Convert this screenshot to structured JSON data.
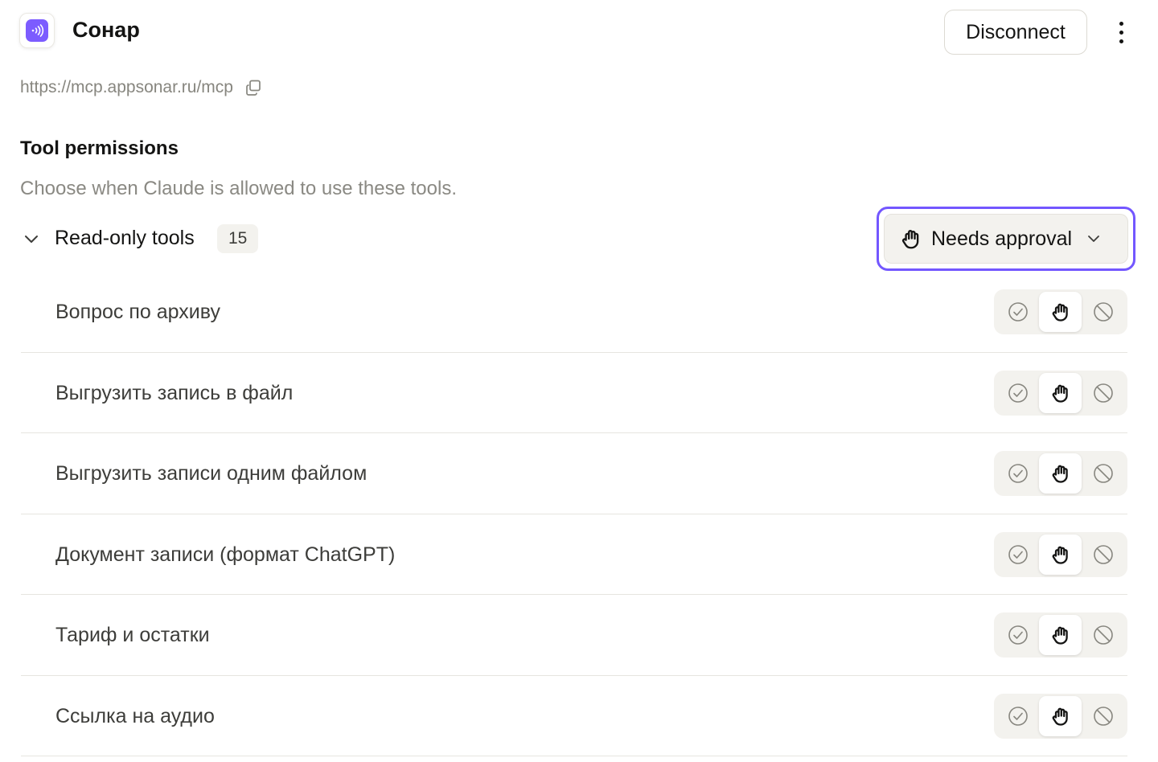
{
  "header": {
    "app_name": "Сонар",
    "disconnect_label": "Disconnect"
  },
  "connection": {
    "url": "https://mcp.appsonar.ru/mcp"
  },
  "permissions": {
    "title": "Tool permissions",
    "description": "Choose when Claude is allowed to use these tools."
  },
  "group": {
    "label": "Read-only tools",
    "count": "15",
    "selected_permission": "Needs approval"
  },
  "tools": [
    {
      "name": "Вопрос по архиву",
      "permission": "needs-approval"
    },
    {
      "name": "Выгрузить запись в файл",
      "permission": "needs-approval"
    },
    {
      "name": "Выгрузить записи одним файлом",
      "permission": "needs-approval"
    },
    {
      "name": "Документ записи (формат ChatGPT)",
      "permission": "needs-approval"
    },
    {
      "name": "Тариф и остатки",
      "permission": "needs-approval"
    },
    {
      "name": "Ссылка на аудио",
      "permission": "needs-approval"
    }
  ],
  "icons": {
    "app": "sonar-waves-icon",
    "copy": "copy-icon",
    "collapse": "chevron-down-icon",
    "allow": "check-circle-icon",
    "approval": "hand-icon",
    "block": "block-icon",
    "more": "more-vertical-icon"
  },
  "colors": {
    "accent": "#7357ff",
    "app_icon": "#7c5cff"
  }
}
